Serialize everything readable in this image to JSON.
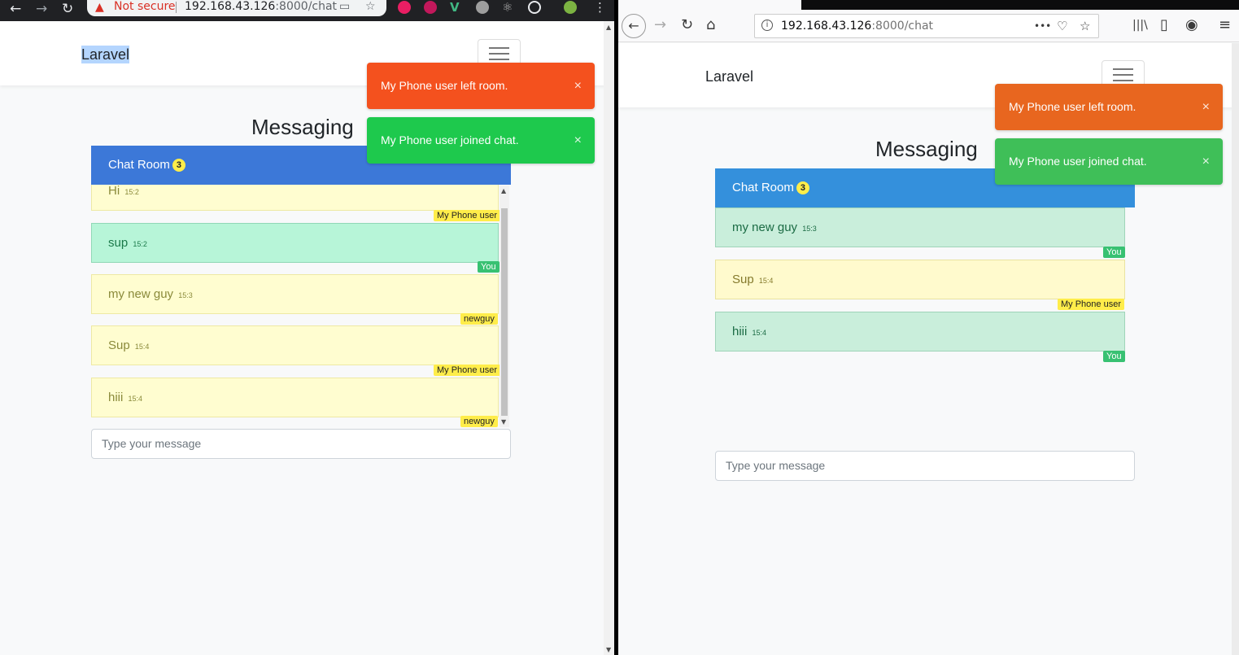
{
  "chrome": {
    "back_glyph": "←",
    "forward_glyph": "→",
    "reload_glyph": "↻",
    "security_icon": "▲",
    "security_label": "Not secure",
    "url_host": "192.168.43.126",
    "url_path": ":8000/chat",
    "cast_icon": "▭",
    "star_icon": "☆",
    "menu_icon": "⋮"
  },
  "firefox": {
    "back_glyph": "←",
    "forward_glyph": "→",
    "reload_glyph": "↻",
    "home_glyph": "⌂",
    "info_icon": "i",
    "url_host": "192.168.43.126",
    "url_path": ":8000/chat",
    "more_icon": "•••",
    "pocket_icon": "♡",
    "star_icon": "☆",
    "library_icon": "|||\\",
    "sidebar_icon": "▯",
    "account_icon": "◉",
    "menu_icon": "≡"
  },
  "left_app": {
    "brand": "Laravel",
    "title": "Messaging",
    "chat_room_label": "Chat Room",
    "user_count": "3",
    "messages": [
      {
        "text": "Hi",
        "time": "15:2",
        "user": "My Phone user",
        "style": "yellow"
      },
      {
        "text": "sup",
        "time": "15:2",
        "user": "You",
        "style": "green"
      },
      {
        "text": "my new guy",
        "time": "15:3",
        "user": "newguy",
        "style": "yellow"
      },
      {
        "text": "Sup",
        "time": "15:4",
        "user": "My Phone user",
        "style": "yellow"
      },
      {
        "text": "hiii",
        "time": "15:4",
        "user": "newguy",
        "style": "yellow"
      }
    ],
    "input_placeholder": "Type your message",
    "toasts": [
      {
        "text": "My Phone user left room.",
        "close": "×"
      },
      {
        "text": "My Phone user joined chat.",
        "close": "×"
      }
    ]
  },
  "right_app": {
    "brand": "Laravel",
    "title": "Messaging",
    "chat_room_label": "Chat Room",
    "user_count": "3",
    "messages": [
      {
        "text": "my new guy",
        "time": "15:3",
        "user": "You",
        "style": "green"
      },
      {
        "text": "Sup",
        "time": "15:4",
        "user": "My Phone user",
        "style": "yellow"
      },
      {
        "text": "hiii",
        "time": "15:4",
        "user": "You",
        "style": "green"
      }
    ],
    "input_placeholder": "Type your message",
    "toasts": [
      {
        "text": "My Phone user left room.",
        "close": "×"
      },
      {
        "text": "My Phone user joined chat.",
        "close": "×"
      }
    ]
  },
  "colors": {
    "header_left": "#3c78d8",
    "header_right": "#3490dc",
    "toast_danger_left": "#f4511e",
    "toast_success_left": "#1ec94d",
    "toast_danger_right": "#e8661f",
    "toast_success_right": "#3fbf58"
  }
}
